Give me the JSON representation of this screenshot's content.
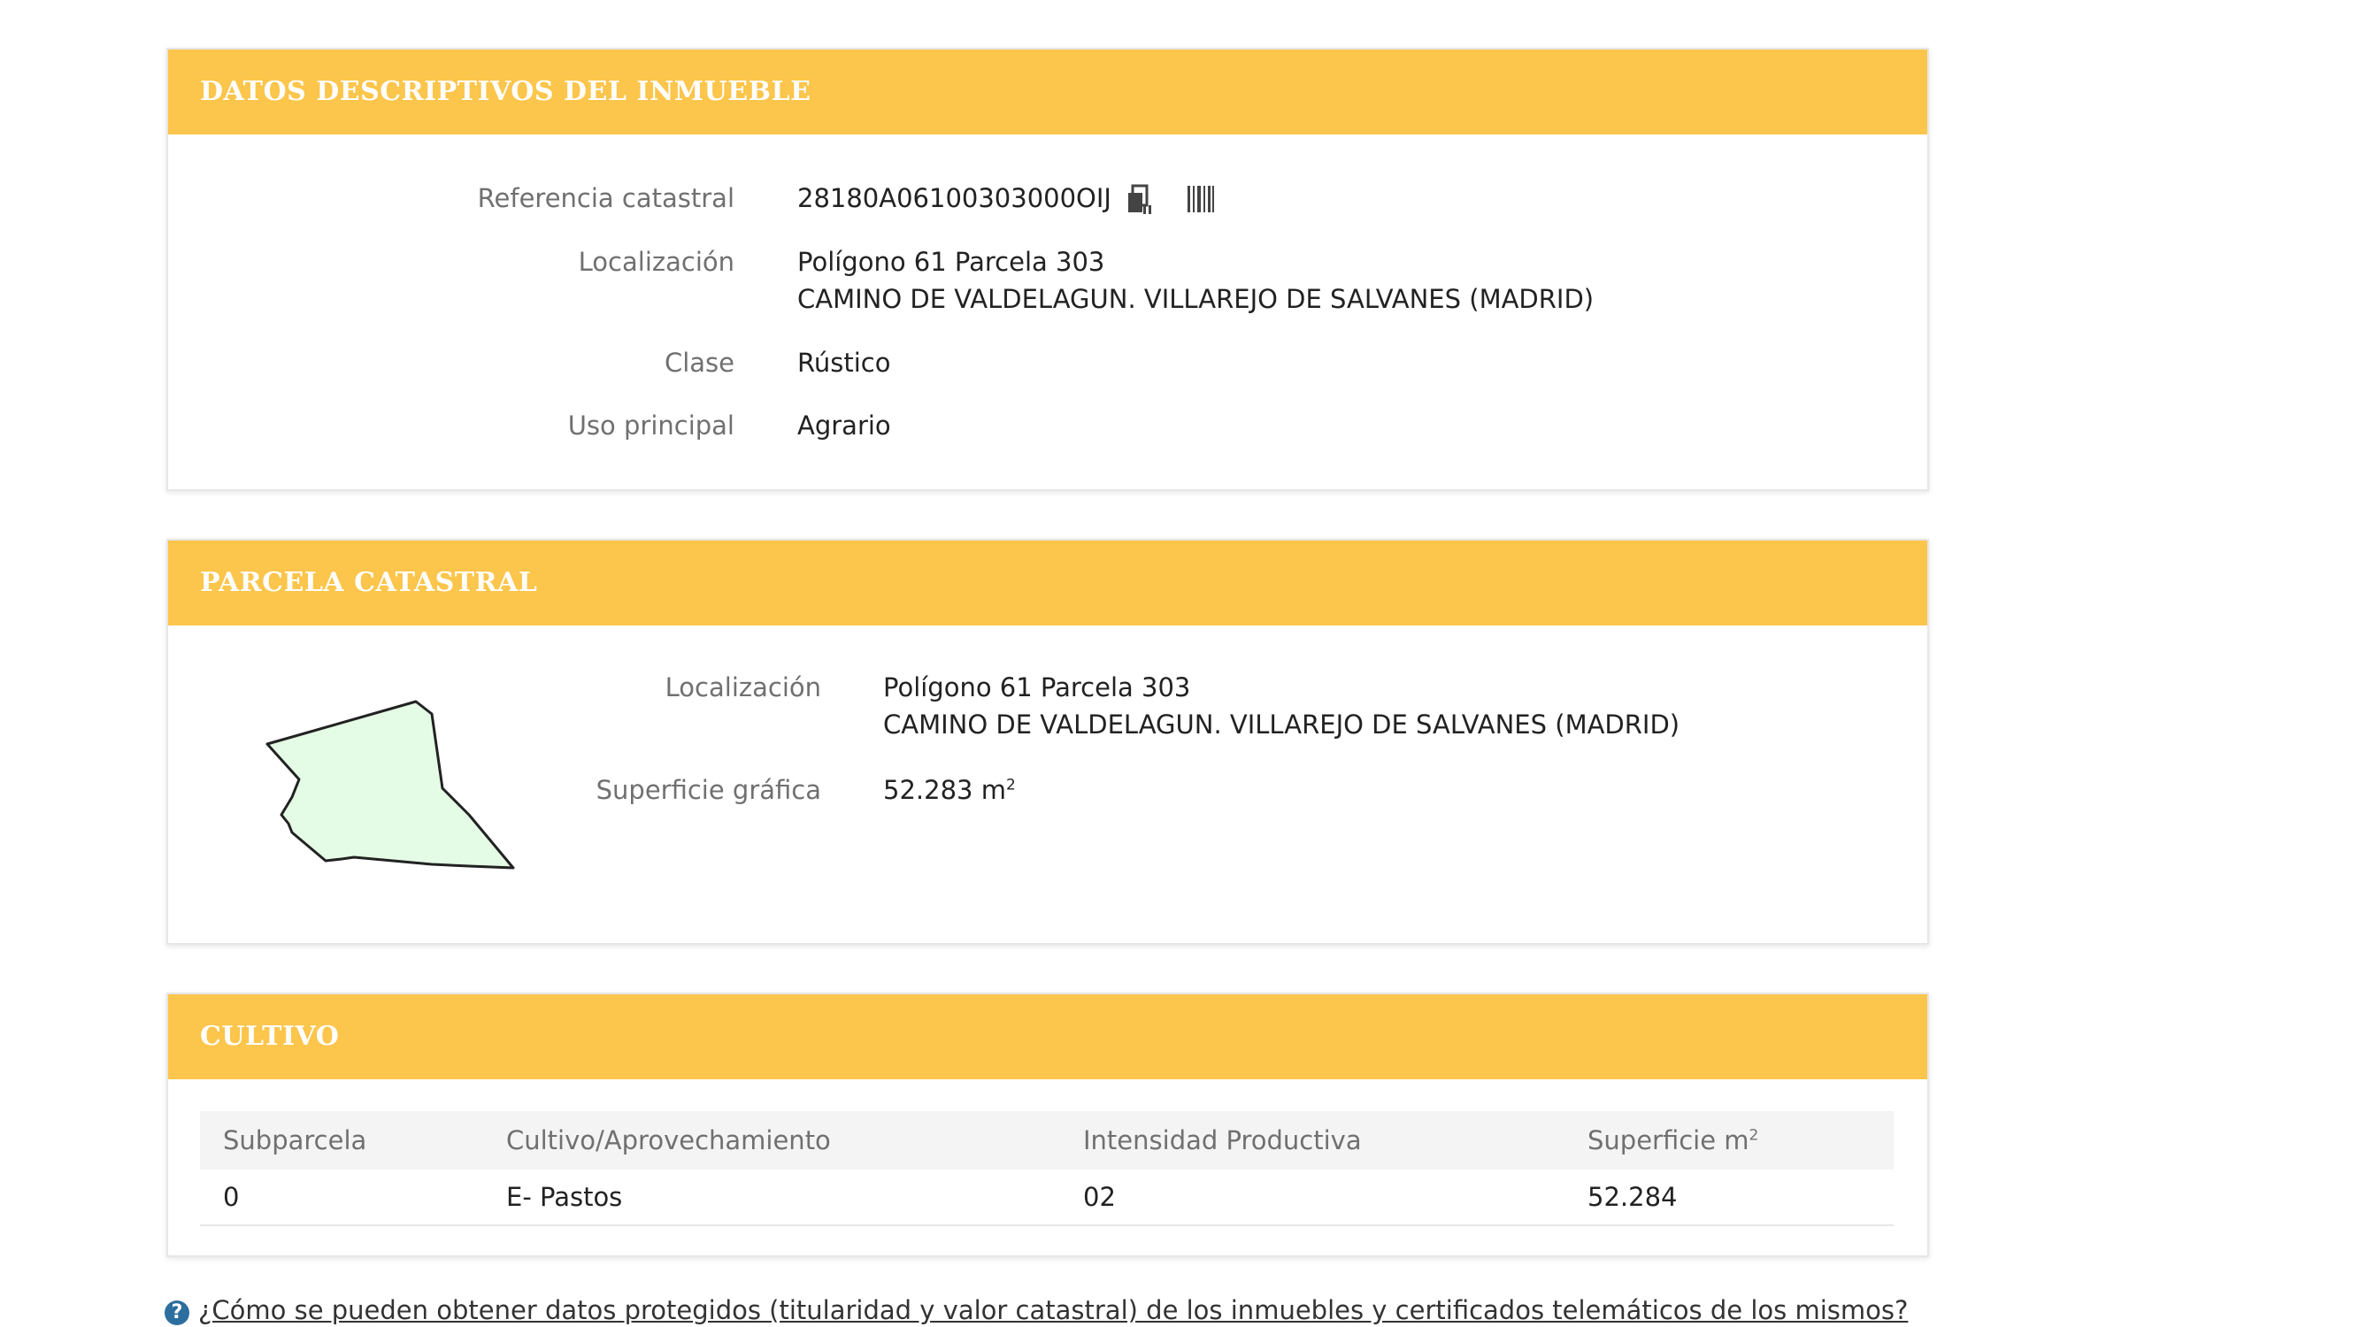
{
  "datos": {
    "header": "DATOS DESCRIPTIVOS DEL INMUEBLE",
    "ref_label": "Referencia catastral",
    "ref_value": "28180A06100303000OIJ",
    "loc_label": "Localización",
    "loc_line1": "Polígono 61 Parcela 303",
    "loc_line2": "CAMINO DE VALDELAGUN. VILLAREJO DE SALVANES (MADRID)",
    "clase_label": "Clase",
    "clase_value": "Rústico",
    "uso_label": "Uso principal",
    "uso_value": "Agrario",
    "icons": [
      "copy-icon",
      "barcode-icon"
    ]
  },
  "parcela": {
    "header": "PARCELA CATASTRAL",
    "loc_label": "Localización",
    "loc_line1": "Polígono 61 Parcela 303",
    "loc_line2": "CAMINO DE VALDELAGUN. VILLAREJO DE SALVANES (MADRID)",
    "sup_label": "Superficie gráfica",
    "sup_value": "52.283 m",
    "sup_unit_exp": "2",
    "shape_fill": "#e4fbe6",
    "shape_stroke": "#222222"
  },
  "cultivo": {
    "header": "CULTIVO",
    "columns": [
      "Subparcela",
      "Cultivo/Aprovechamiento",
      "Intensidad Productiva",
      "Superficie m"
    ],
    "col4_exp": "2",
    "rows": [
      [
        "0",
        "E- Pastos",
        "02",
        "52.284"
      ]
    ]
  },
  "footer": {
    "info_glyph": "?",
    "link_text": "¿Cómo se pueden obtener datos protegidos (titularidad y valor catastral) de los inmuebles y certificados telemáticos de los mismos?"
  },
  "colors": {
    "header_bg": "#fcc54b",
    "header_text": "#ffffff"
  }
}
